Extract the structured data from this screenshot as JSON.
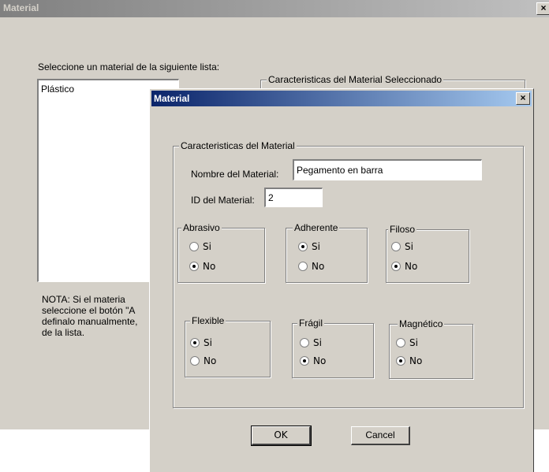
{
  "background_window": {
    "title": "Material",
    "close_glyph": "×",
    "list_prompt": "Seleccione un material de la siguiente lista:",
    "list_items": [
      "Plástico"
    ],
    "group_title": "Caracteristicas del Material Seleccionado",
    "note_lines": [
      "NOTA:    Si el materia",
      "seleccione el botón \"A",
      "definalo manualmente,",
      "de la lista."
    ]
  },
  "dialog": {
    "title": "Material",
    "close_glyph": "×",
    "group_title": "Caracteristicas del Material",
    "name_label": "Nombre del Material:",
    "name_value": "Pegamento en barra",
    "id_label": "ID del Material:",
    "id_value": "2",
    "properties": [
      {
        "title": "Abrasivo",
        "si_label": "Si",
        "no_label": "No",
        "selected": "No"
      },
      {
        "title": "Adherente",
        "si_label": "Si",
        "no_label": "No",
        "selected": "Si"
      },
      {
        "title": "Filoso",
        "si_label": "Si",
        "no_label": "No",
        "selected": "No"
      },
      {
        "title": "Flexible",
        "si_label": "Si",
        "no_label": "No",
        "selected": "Si"
      },
      {
        "title": "Frágil",
        "si_label": "Si",
        "no_label": "No",
        "selected": "No"
      },
      {
        "title": "Magnético",
        "si_label": "Si",
        "no_label": "No",
        "selected": "No"
      }
    ],
    "ok_label": "OK",
    "cancel_label": "Cancel"
  },
  "colors": {
    "face": "#d4d0c8",
    "active_title": "#0a246a",
    "inactive_title": "#808080"
  }
}
